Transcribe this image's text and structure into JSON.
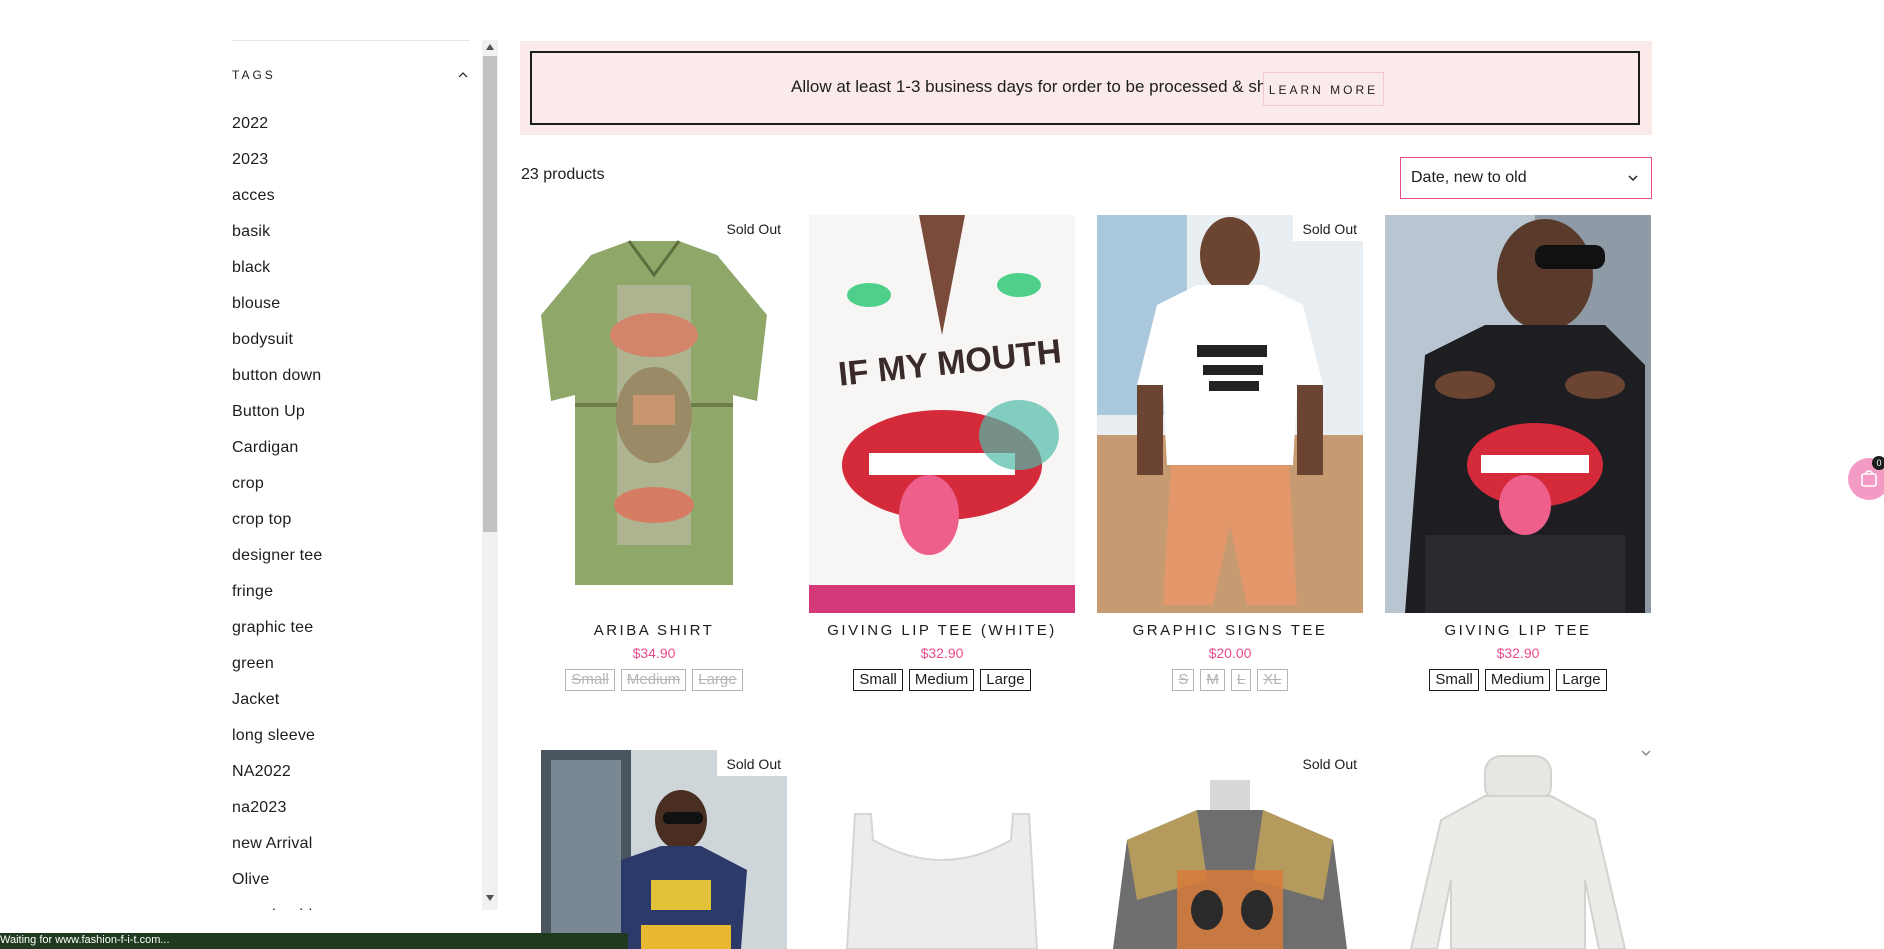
{
  "sidebar": {
    "tags_title": "TAGS",
    "tags": [
      "2022",
      "2023",
      "acces",
      "basik",
      "black",
      "blouse",
      "bodysuit",
      "button down",
      "Button Up",
      "Cardigan",
      "crop",
      "crop top",
      "designer tee",
      "fringe",
      "graphic tee",
      "green",
      "Jacket",
      "long sleeve",
      "NA2022",
      "na2023",
      "new Arrival",
      "Olive",
      "one shoulder"
    ]
  },
  "banner": {
    "text": "Allow at least 1-3 business days for order to be processed & shipped",
    "button_label": "LEARN MORE"
  },
  "toolbar": {
    "product_count": "23 products",
    "sort_value": "Date, new to old"
  },
  "products": [
    {
      "title": "ARIBA SHIRT",
      "price": "$34.90",
      "sold_out": "Sold Out",
      "sizes": [
        {
          "label": "Small",
          "available": false
        },
        {
          "label": "Medium",
          "available": false
        },
        {
          "label": "Large",
          "available": false
        }
      ]
    },
    {
      "title": "GIVING LIP TEE (WHITE)",
      "price": "$32.90",
      "sold_out": "",
      "sizes": [
        {
          "label": "Small",
          "available": true
        },
        {
          "label": "Medium",
          "available": true
        },
        {
          "label": "Large",
          "available": true
        }
      ]
    },
    {
      "title": "GRAPHIC SIGNS TEE",
      "price": "$20.00",
      "sold_out": "Sold Out",
      "sizes": [
        {
          "label": "S",
          "available": false
        },
        {
          "label": "M",
          "available": false
        },
        {
          "label": "L",
          "available": false
        },
        {
          "label": "XL",
          "available": false
        }
      ]
    },
    {
      "title": "GIVING LIP TEE",
      "price": "$32.90",
      "sold_out": "",
      "sizes": [
        {
          "label": "Small",
          "available": true
        },
        {
          "label": "Medium",
          "available": true
        },
        {
          "label": "Large",
          "available": true
        }
      ]
    },
    {
      "sold_out": "Sold Out"
    },
    {
      "sold_out": ""
    },
    {
      "sold_out": "Sold Out"
    },
    {
      "sold_out": ""
    }
  ],
  "cart": {
    "count": "0"
  },
  "status_bar": {
    "text": "Waiting for www.fashion-f-i-t.com..."
  },
  "colors": {
    "accent_pink": "#e94a8e",
    "banner_bg": "#fbeaea",
    "text": "#1c1d1d"
  },
  "icons": [
    "chevron-up-icon",
    "chevron-down-icon",
    "shopping-bag-icon"
  ]
}
